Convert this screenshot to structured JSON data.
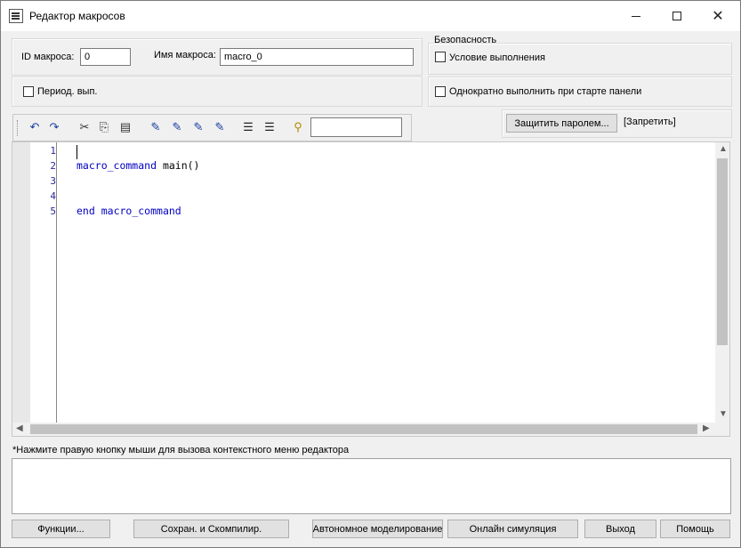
{
  "window": {
    "title": "Редактор макросов"
  },
  "macro": {
    "id_label": "ID макроса:",
    "id_value": "0",
    "name_label": "Имя макроса:",
    "name_value": "macro_0",
    "periodic_label": "Период. вып."
  },
  "security": {
    "group_label": "Безопасность",
    "condition_label": "Условие выполнения",
    "run_once_label": "Однократно выполнить при старте панели",
    "password_button": "Защитить паролем...",
    "password_status": "[Запретить]"
  },
  "editor": {
    "line_numbers": [
      "1",
      "2",
      "3",
      "4",
      "5"
    ],
    "line2_keyword": "macro_command",
    "line2_rest": " main()",
    "line5_keyword1": "end",
    "line5_keyword2": "macro_command"
  },
  "hint_text": "*Нажмите правую кнопку мыши для вызова контекстного меню редактора",
  "buttons": {
    "functions": "Функции...",
    "save_compile": "Сохран. и Скомпилир.",
    "offline_sim": "Автономное моделирование",
    "online_sim": "Онлайн симуляция",
    "exit": "Выход",
    "help": "Помощь"
  }
}
